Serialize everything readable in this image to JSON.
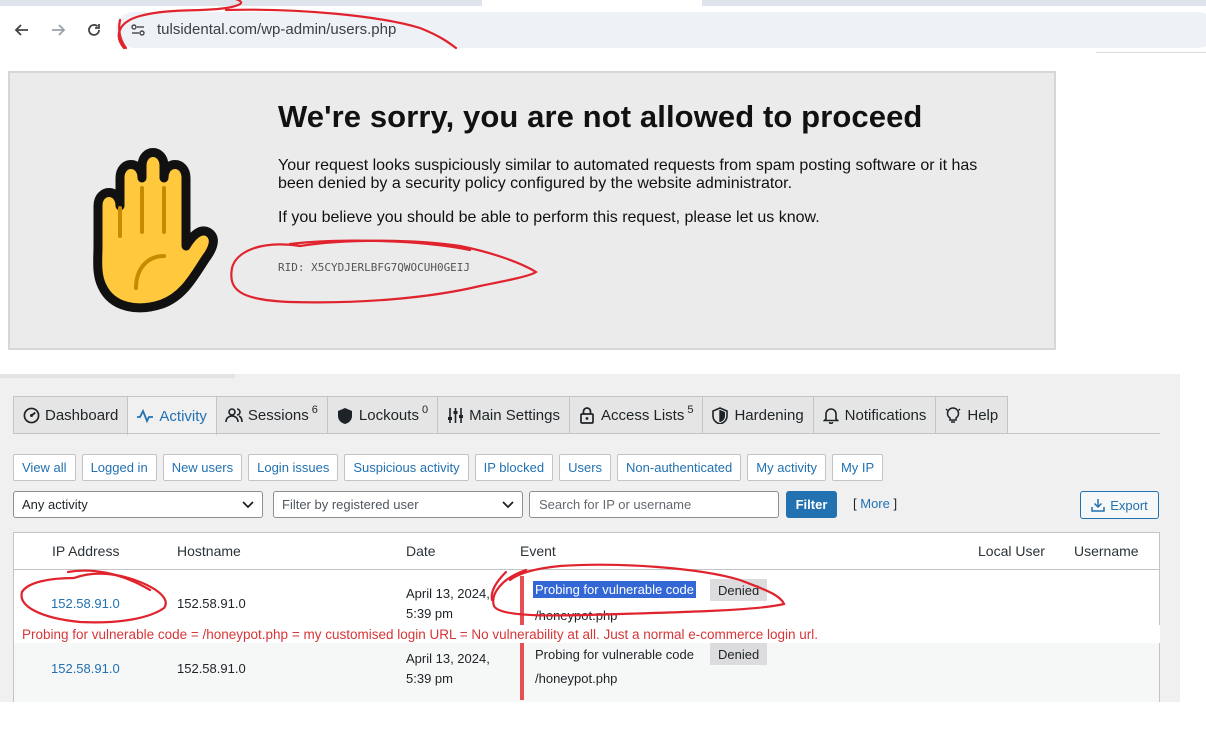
{
  "browser": {
    "url": "tulsidental.com/wp-admin/users.php"
  },
  "block_page": {
    "title": "We're sorry, you are not allowed to proceed",
    "message1": "Your request looks suspiciously similar to automated requests from spam posting software or it has been denied by a security policy configured by the website administrator.",
    "message2": "If you believe you should be able to perform this request, please let us know.",
    "rid": "RID: X5CYDJERLBFG7QWOCUH0GEIJ"
  },
  "tabs": [
    {
      "label": "Dashboard",
      "icon": "dashboard-gauge-icon"
    },
    {
      "label": "Activity",
      "icon": "activity-pulse-icon",
      "active": true
    },
    {
      "label": "Sessions",
      "icon": "users-icon",
      "count": "6"
    },
    {
      "label": "Lockouts",
      "icon": "shield-icon",
      "count": "0"
    },
    {
      "label": "Main Settings",
      "icon": "sliders-icon"
    },
    {
      "label": "Access Lists",
      "icon": "lock-icon",
      "count": "5"
    },
    {
      "label": "Hardening",
      "icon": "shield-check-icon"
    },
    {
      "label": "Notifications",
      "icon": "bell-icon"
    },
    {
      "label": "Help",
      "icon": "lightbulb-icon"
    }
  ],
  "quick_filters": [
    "View all",
    "Logged in",
    "New users",
    "Login issues",
    "Suspicious activity",
    "IP blocked",
    "Users",
    "Non-authenticated",
    "My activity",
    "My IP"
  ],
  "controls": {
    "activity_select": "Any activity",
    "user_select_placeholder": "Filter by registered user",
    "search_placeholder": "Search for IP or username",
    "filter_label": "Filter",
    "more_label": "More",
    "export_label": "Export"
  },
  "table": {
    "columns": [
      "IP Address",
      "Hostname",
      "Date",
      "Event",
      "Local User",
      "Username"
    ],
    "rows": [
      {
        "ip": "152.58.91.0",
        "hostname": "152.58.91.0",
        "date_line1": "April 13, 2024,",
        "date_line2": "5:39 pm",
        "event": "Probing for vulnerable code",
        "status": "Denied",
        "path": "/honeypot.php"
      },
      {
        "ip": "152.58.91.0",
        "hostname": "152.58.91.0",
        "date_line1": "April 13, 2024,",
        "date_line2": "5:39 pm",
        "event": "Probing for vulnerable code",
        "status": "Denied",
        "path": "/honeypot.php"
      }
    ]
  },
  "annotation": "Probing for vulnerable code = /honeypot.php = my customised login URL = No vulnerability at all. Just a normal e-commerce login url.",
  "colors": {
    "accent": "#2271b1",
    "event_bar": "#e65054",
    "annotation": "#d63638",
    "hand": "#FFC83D"
  }
}
